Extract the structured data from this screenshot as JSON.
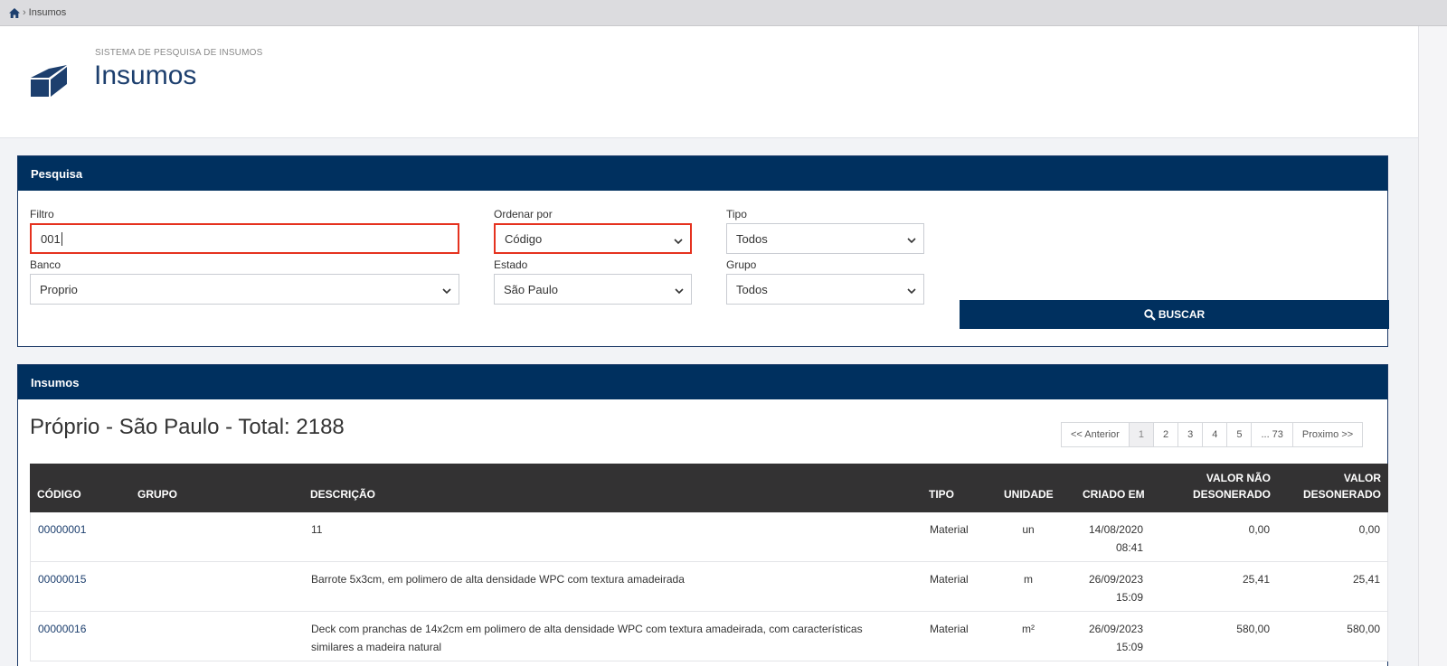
{
  "breadcrumb": {
    "current": "Insumos"
  },
  "header": {
    "subtitle": "SISTEMA DE PESQUISA DE INSUMOS",
    "title": "Insumos"
  },
  "search": {
    "panel_title": "Pesquisa",
    "filtro_label": "Filtro",
    "filtro_value": "001",
    "ordenar_label": "Ordenar por",
    "ordenar_value": "Código",
    "tipo_label": "Tipo",
    "tipo_value": "Todos",
    "banco_label": "Banco",
    "banco_value": "Proprio",
    "estado_label": "Estado",
    "estado_value": "São Paulo",
    "grupo_label": "Grupo",
    "grupo_value": "Todos",
    "buscar_label": "BUSCAR"
  },
  "results": {
    "panel_title": "Insumos",
    "summary": "Próprio - São Paulo - Total: 2188",
    "pagination": [
      "<< Anterior",
      "1",
      "2",
      "3",
      "4",
      "5",
      "... 73",
      "Proximo >>"
    ],
    "columns": {
      "codigo": "CÓDIGO",
      "grupo": "GRUPO",
      "descricao": "DESCRIÇÃO",
      "tipo": "TIPO",
      "unidade": "UNIDADE",
      "criado": "CRIADO EM",
      "nao_des": "VALOR NÃO DESONERADO",
      "des": "VALOR DESONERADO"
    },
    "rows": [
      {
        "codigo": "00000001",
        "grupo": "",
        "descricao": "11",
        "tipo": "Material",
        "unidade": "un",
        "criado_data": "14/08/2020",
        "criado_hora": "08:41",
        "nao_des": "0,00",
        "des": "0,00"
      },
      {
        "codigo": "00000015",
        "grupo": "",
        "descricao": "Barrote 5x3cm, em polimero de alta densidade WPC com textura amadeirada",
        "tipo": "Material",
        "unidade": "m",
        "criado_data": "26/09/2023",
        "criado_hora": "15:09",
        "nao_des": "25,41",
        "des": "25,41"
      },
      {
        "codigo": "00000016",
        "grupo": "",
        "descricao": "Deck com pranchas de 14x2cm em polimero de alta densidade WPC com textura amadeirada, com características similares a madeira natural",
        "tipo": "Material",
        "unidade": "m²",
        "criado_data": "26/09/2023",
        "criado_hora": "15:09",
        "nao_des": "580,00",
        "des": "580,00"
      }
    ]
  },
  "icons": {
    "home": "home-icon",
    "logo": "cube-icon",
    "search": "search-icon",
    "chevron": "chevron-down-icon"
  },
  "colors": {
    "primary": "#00305f",
    "title": "#1d3f6e",
    "highlight": "#e5321f",
    "table_header": "#333233"
  }
}
